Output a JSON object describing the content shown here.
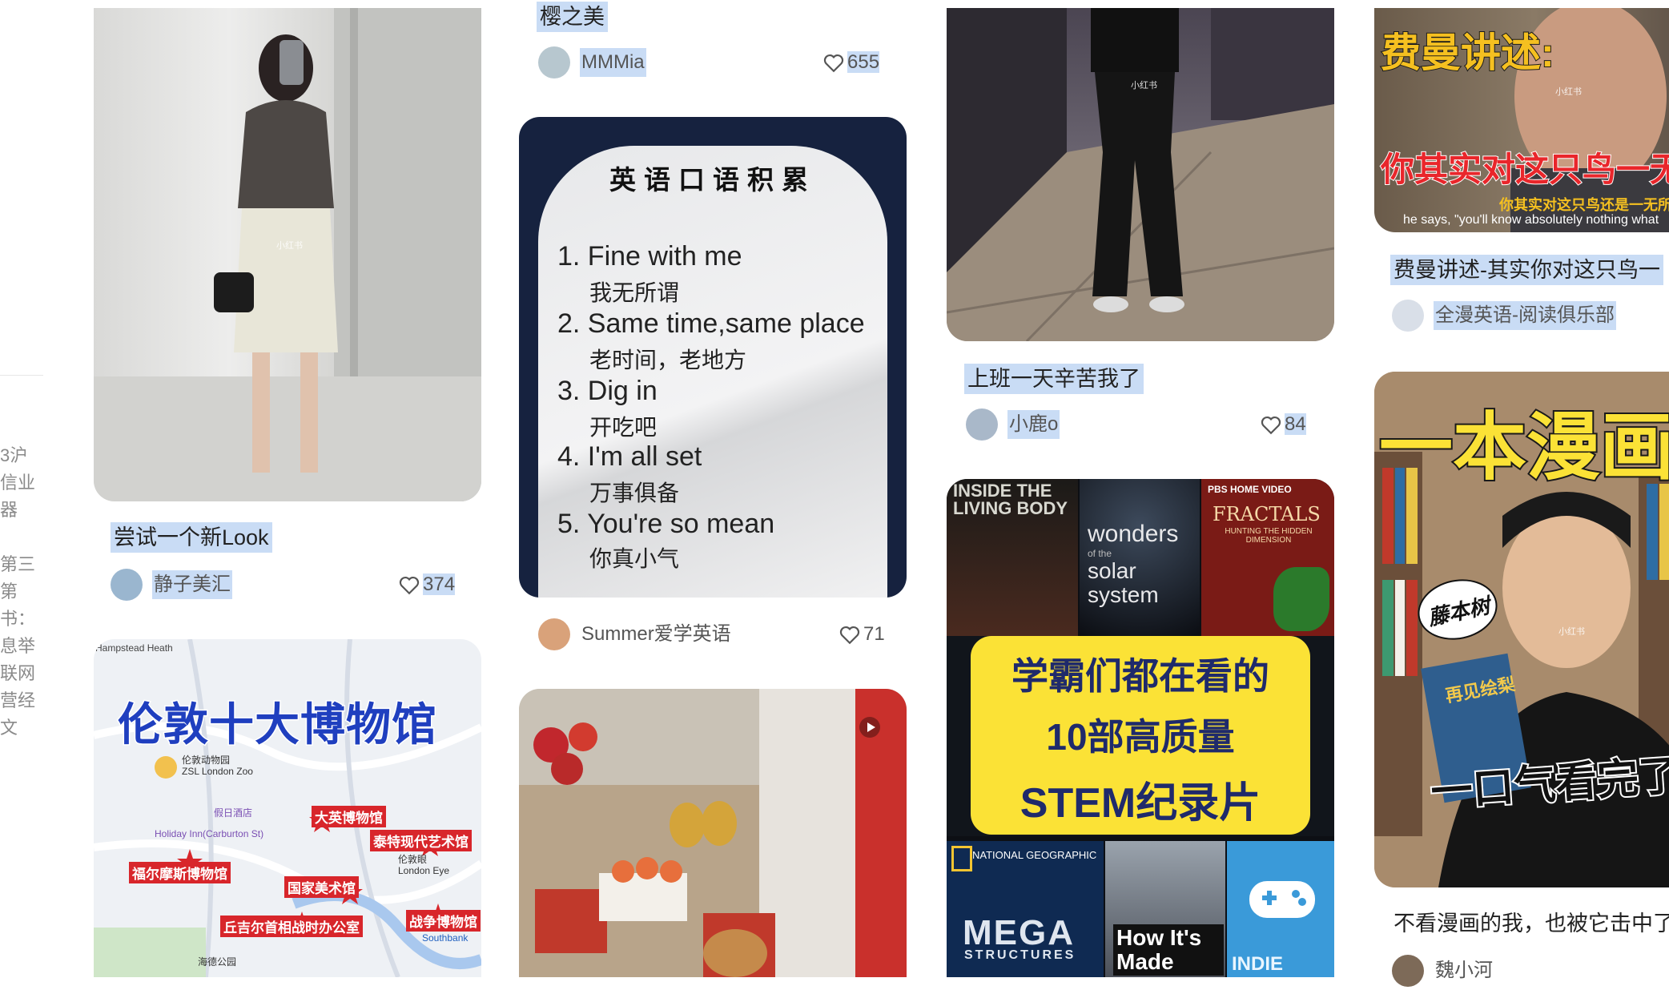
{
  "sidebar_edge": {
    "lines_a": [
      "3沪",
      "信业",
      "器"
    ],
    "lines_b": [
      "第三",
      "第",
      "书：",
      "息举",
      "联网",
      "营经",
      "文"
    ]
  },
  "cards": {
    "c1": {
      "title": "尝试一个新Look",
      "author": "静子美汇",
      "likes": "374",
      "watermark": "小红书"
    },
    "c2": {
      "title": "伦敦十大博物馆",
      "labels": {
        "heath": "Hampstead Heath",
        "zoo_cn": "伦敦动物园",
        "zoo_en": "ZSL London Zoo",
        "hotel_cn": "假日酒店",
        "hotel_en": "Holiday Inn(Carburton St)",
        "british_museum": "大英博物馆",
        "tate": "泰特现代艺术馆",
        "sherlock": "福尔摩斯博物馆",
        "eye_cn": "伦敦眼",
        "eye_en": "London Eye",
        "national_gallery": "国家美术馆",
        "churchill": "丘吉尔首相战时办公室",
        "war_museum": "战争博物馆",
        "hyde_park": "海德公园",
        "southbank": "Southbank"
      }
    },
    "c3": {
      "title_partial": "樱之美",
      "author": "MMMia",
      "likes": "655"
    },
    "c4": {
      "cover_title": "英语口语积累",
      "items": [
        {
          "en": "1. Fine with me",
          "cn": "我无所谓"
        },
        {
          "en": "2. Same time,same place",
          "cn": "老时间，老地方"
        },
        {
          "en": "3. Dig in",
          "cn": "开吃吧"
        },
        {
          "en": "4. I'm all set",
          "cn": "万事俱备"
        },
        {
          "en": "5. You're so mean",
          "cn": "你真小气"
        }
      ],
      "author": "Summer爱学英语",
      "likes": "71"
    },
    "c5": {},
    "c6": {
      "title": "上班一天辛苦我了",
      "author": "小鹿o",
      "likes": "84",
      "watermark": "小红书"
    },
    "c7": {
      "posters": {
        "p1": "INSIDE THE LIVING BODY",
        "p2a": "wonders",
        "p2b": "of the",
        "p2c": "solar",
        "p2d": "system",
        "p3a": "PBS HOME VIDEO",
        "p3b": "FRACTALS",
        "p3c": "HUNTING THE HIDDEN DIMENSION",
        "p4a": "NATIONAL GEOGRAPHIC",
        "p4b": "MEGA",
        "p4c": "STRUCTURES",
        "p5": "How It's Made",
        "p6": "INDIE GAME"
      },
      "banner": [
        "学霸们都在看的",
        "10部高质量",
        "STEM纪录片"
      ]
    },
    "c8": {
      "overlay_title": "费曼讲述:",
      "subtitle_big": "你其实对这只鸟一无",
      "subtitle_small": "你其实对这只鸟还是一无所",
      "subtitle_en": "he says, \"you'll know absolutely nothing what",
      "title": "费曼讲述-其实你对这只鸟一",
      "author": "全漫英语-阅读俱乐部",
      "watermark": "小红书"
    },
    "c9": {
      "overlay_top": "一本漫画",
      "badge": "藤本树",
      "book": "再见绘梨",
      "overlay_bottom": "一口气看完了",
      "title": "不看漫画的我，也被它击中了",
      "author": "魏小河",
      "watermark": "小红书"
    }
  },
  "colors": {
    "highlight": "#c9dcf5",
    "red_banner": "#e9262b",
    "yellow_banner": "#fbe236",
    "navy": "#16223f"
  }
}
